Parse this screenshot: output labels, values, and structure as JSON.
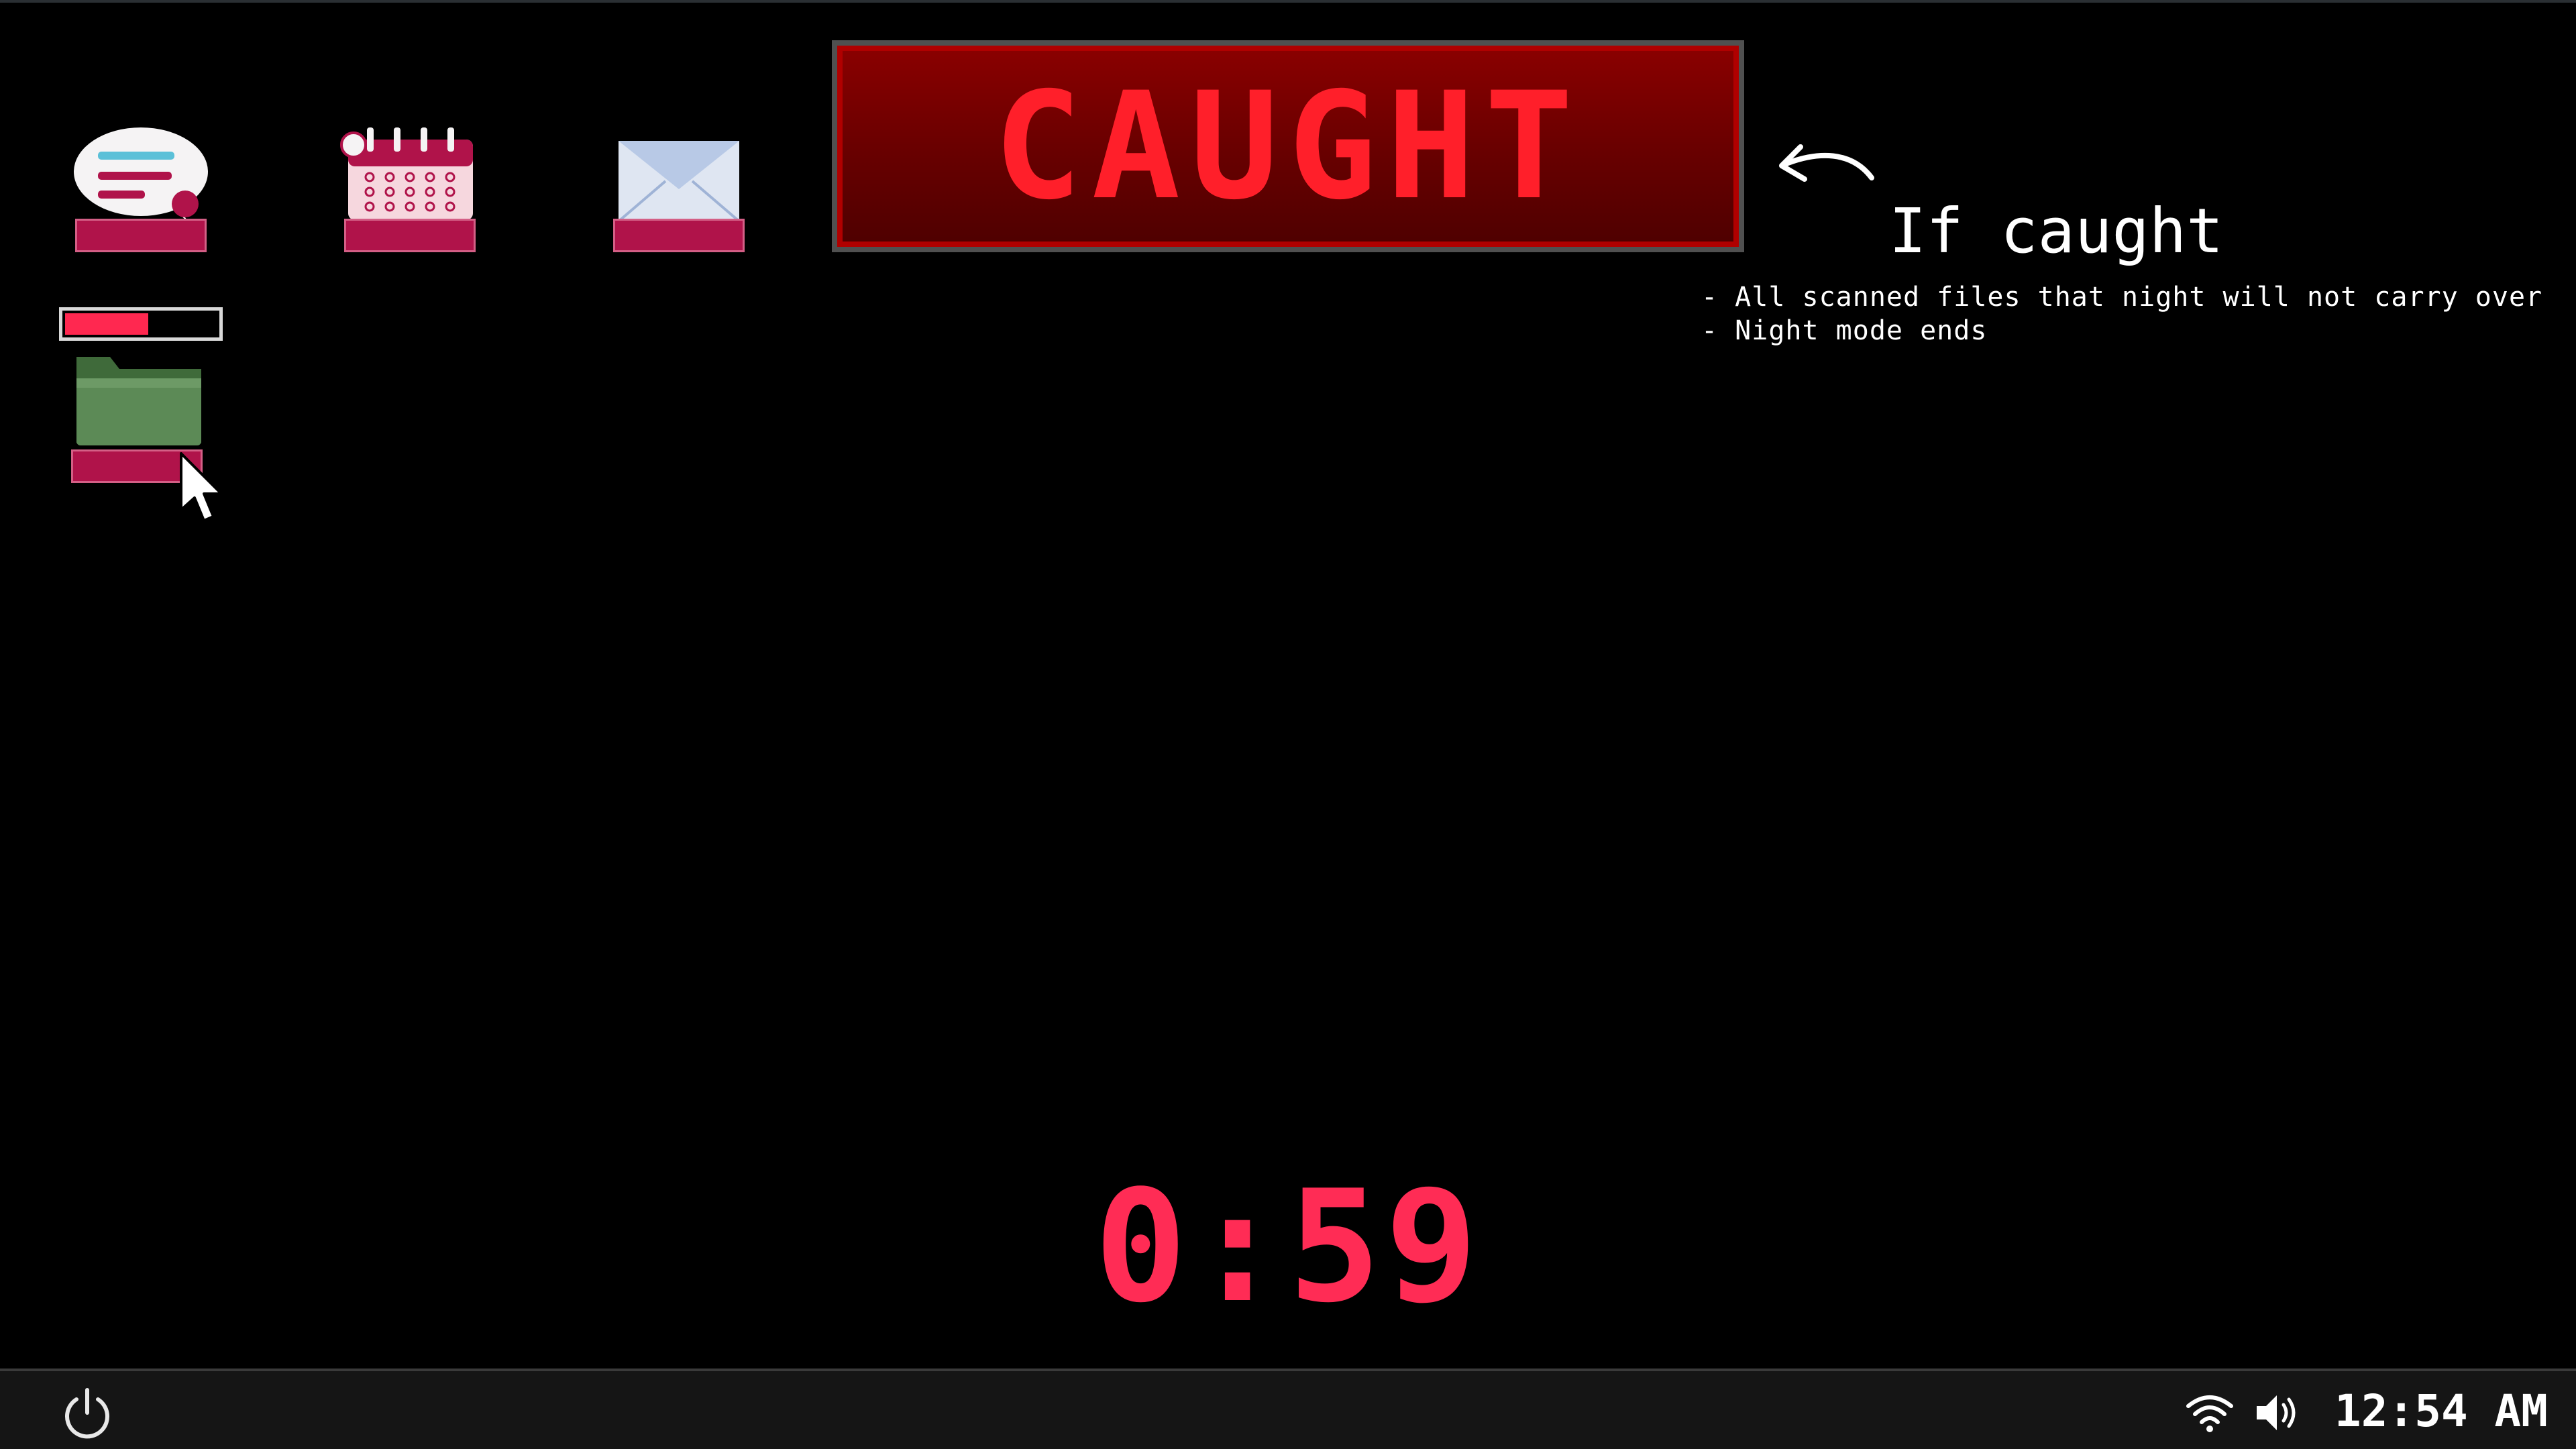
{
  "desktop": {
    "icons": [
      {
        "name": "messenger",
        "label": "",
        "icon": "chat-bubble-icon"
      },
      {
        "name": "calendar",
        "label": "",
        "icon": "calendar-icon"
      },
      {
        "name": "email",
        "label": "",
        "icon": "envelope-icon"
      },
      {
        "name": "folder",
        "label": "",
        "icon": "folder-icon"
      }
    ],
    "scan_progress": 0.55
  },
  "alert": {
    "banner": "CAUGHT",
    "heading": "If caught",
    "lines": [
      "- All scanned files that night will not carry over",
      "- Night mode ends"
    ]
  },
  "countdown": "0:59",
  "taskbar": {
    "power_icon": "power-icon",
    "wifi_icon": "wifi-icon",
    "volume_icon": "speaker-icon",
    "clock": "12:54 AM"
  },
  "colors": {
    "accent": "#ff2c55",
    "banner_bg": "#6a0000",
    "banner_text": "#ff1f2a",
    "label_bg": "#b0134a",
    "taskbar_bg": "#151515"
  }
}
